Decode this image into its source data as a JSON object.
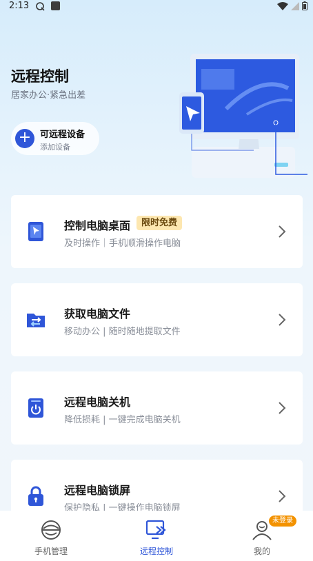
{
  "status_bar": {
    "time": "2:13"
  },
  "hero": {
    "title": "远程控制",
    "subtitle": "居家办公·紧急出差"
  },
  "device_pill": {
    "title": "可远程设备",
    "subtitle": "添加设备",
    "icon": "plus-icon"
  },
  "cards": [
    {
      "title": "控制电脑桌面",
      "badge": "限时免费",
      "desc": "及时操作｜手机顺滑操作电脑",
      "icon": "tablet-pointer-icon"
    },
    {
      "title": "获取电脑文件",
      "desc": "移动办公 | 随时随地提取文件",
      "icon": "folder-transfer-icon"
    },
    {
      "title": "远程电脑关机",
      "desc": "降低损耗 | 一键完成电脑关机",
      "icon": "power-icon"
    },
    {
      "title": "远程电脑锁屏",
      "desc": "保护隐私 | 一键操作电脑锁屏",
      "icon": "lock-icon"
    }
  ],
  "bottom_nav": {
    "items": [
      {
        "label": "手机管理",
        "icon": "phone-manage-icon",
        "active": false
      },
      {
        "label": "远程控制",
        "icon": "remote-control-icon",
        "active": true
      },
      {
        "label": "我的",
        "icon": "profile-icon",
        "active": false,
        "badge": "未登录"
      }
    ]
  },
  "colors": {
    "accent": "#2f56d8",
    "badge_bg": "#fde7b0",
    "login_badge": "#f39200"
  }
}
